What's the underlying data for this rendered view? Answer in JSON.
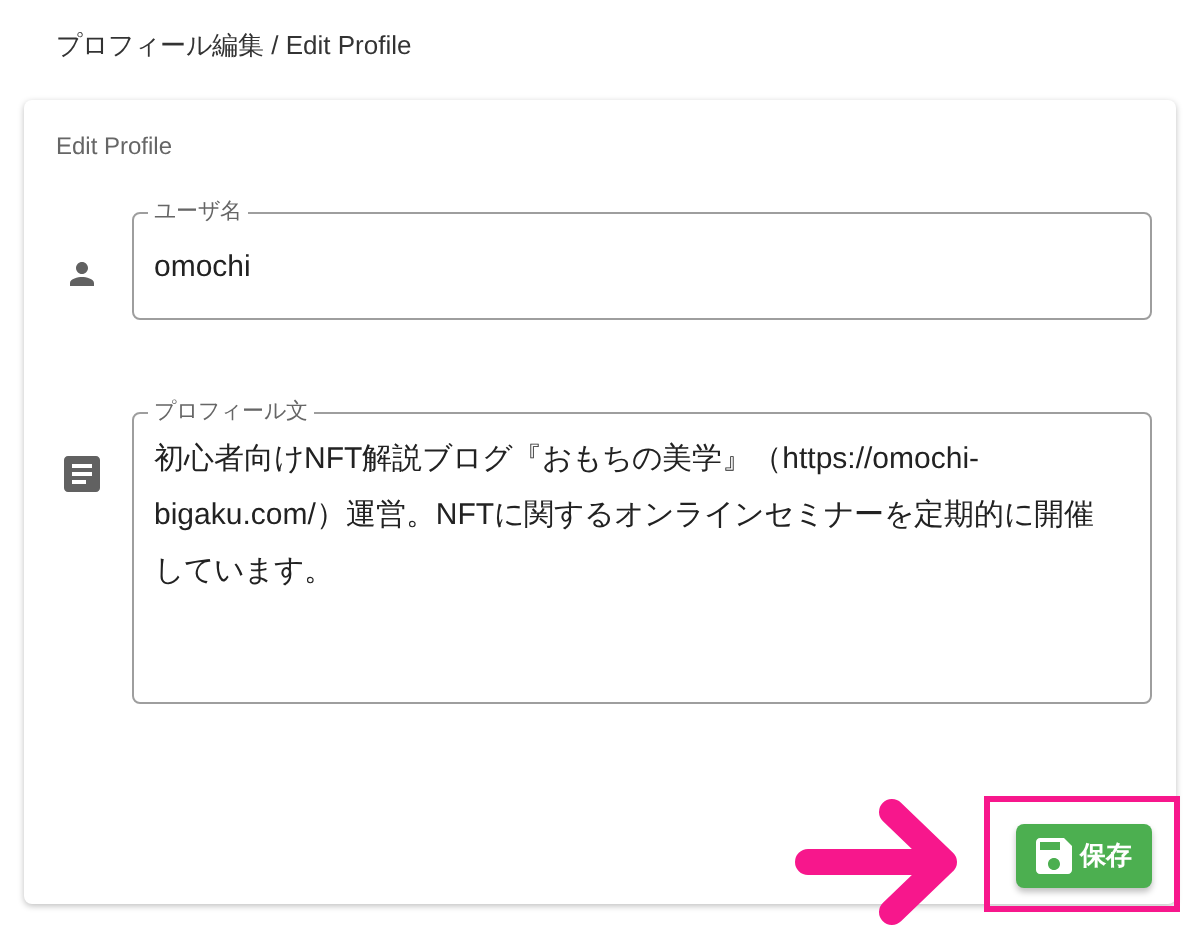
{
  "breadcrumb": "プロフィール編集 / Edit Profile",
  "card": {
    "title": "Edit Profile",
    "fields": [
      {
        "kind": "single",
        "label": "ユーザ名",
        "value": "omochi"
      },
      {
        "kind": "multi",
        "label": "プロフィール文",
        "value": "初心者向けNFT解説ブログ『おもちの美学』（https://omochi-bigaku.com/）運営。NFTに関するオンラインセミナーを定期的に開催しています。"
      }
    ],
    "save_button": "保存"
  }
}
